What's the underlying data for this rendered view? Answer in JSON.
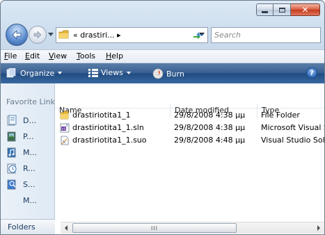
{
  "window": {
    "caption_buttons": {
      "minimize": "–",
      "maximize": "□",
      "close": "✕"
    }
  },
  "navbar": {
    "address_prefix": "«",
    "address_text": "drastiri...",
    "address_chevron": "▸",
    "search_placeholder": "Search"
  },
  "menu": {
    "items": [
      {
        "label": "File",
        "accel": "F",
        "rest": "ile"
      },
      {
        "label": "Edit",
        "accel": "E",
        "rest": "dit"
      },
      {
        "label": "View",
        "accel": "V",
        "rest": "iew"
      },
      {
        "label": "Tools",
        "accel": "T",
        "rest": "ools"
      },
      {
        "label": "Help",
        "accel": "H",
        "rest": "elp"
      }
    ]
  },
  "toolbar": {
    "organize": "Organize",
    "views": "Views",
    "burn": "Burn",
    "help": "?"
  },
  "nav_pane": {
    "favorites_title": "Favorite Links",
    "items": [
      {
        "label": "D...",
        "icon": "documents-icon"
      },
      {
        "label": "P...",
        "icon": "pictures-icon"
      },
      {
        "label": "M...",
        "icon": "music-icon"
      },
      {
        "label": "R...",
        "icon": "recently-changed-icon"
      },
      {
        "label": "S...",
        "icon": "searches-icon"
      },
      {
        "label": "M...",
        "icon": "more-icon"
      }
    ],
    "folders_label": "Folders"
  },
  "file_list": {
    "columns": [
      "Name",
      "Date modified",
      "Type"
    ],
    "rows": [
      {
        "name": "drastiriotita1_1",
        "date": "29/8/2008 4:38 μμ",
        "type": "File Folder",
        "icon": "folder-icon"
      },
      {
        "name": "drastiriotita1_1.sln",
        "date": "29/8/2008 4:38 μμ",
        "type": "Microsoft Visual Studio Solution",
        "icon": "sln-file-icon"
      },
      {
        "name": "drastiriotita1_1.suo",
        "date": "29/8/2008 4:48 μμ",
        "type": "Visual Studio Solution User Options",
        "icon": "suo-file-icon"
      }
    ],
    "scroll_grip": "III"
  },
  "colors": {
    "toolbar_top": "#5b7ea8",
    "toolbar_bottom": "#1f4b80",
    "close_red": "#c33c1f",
    "folder_yellow": "#e8b83c"
  }
}
